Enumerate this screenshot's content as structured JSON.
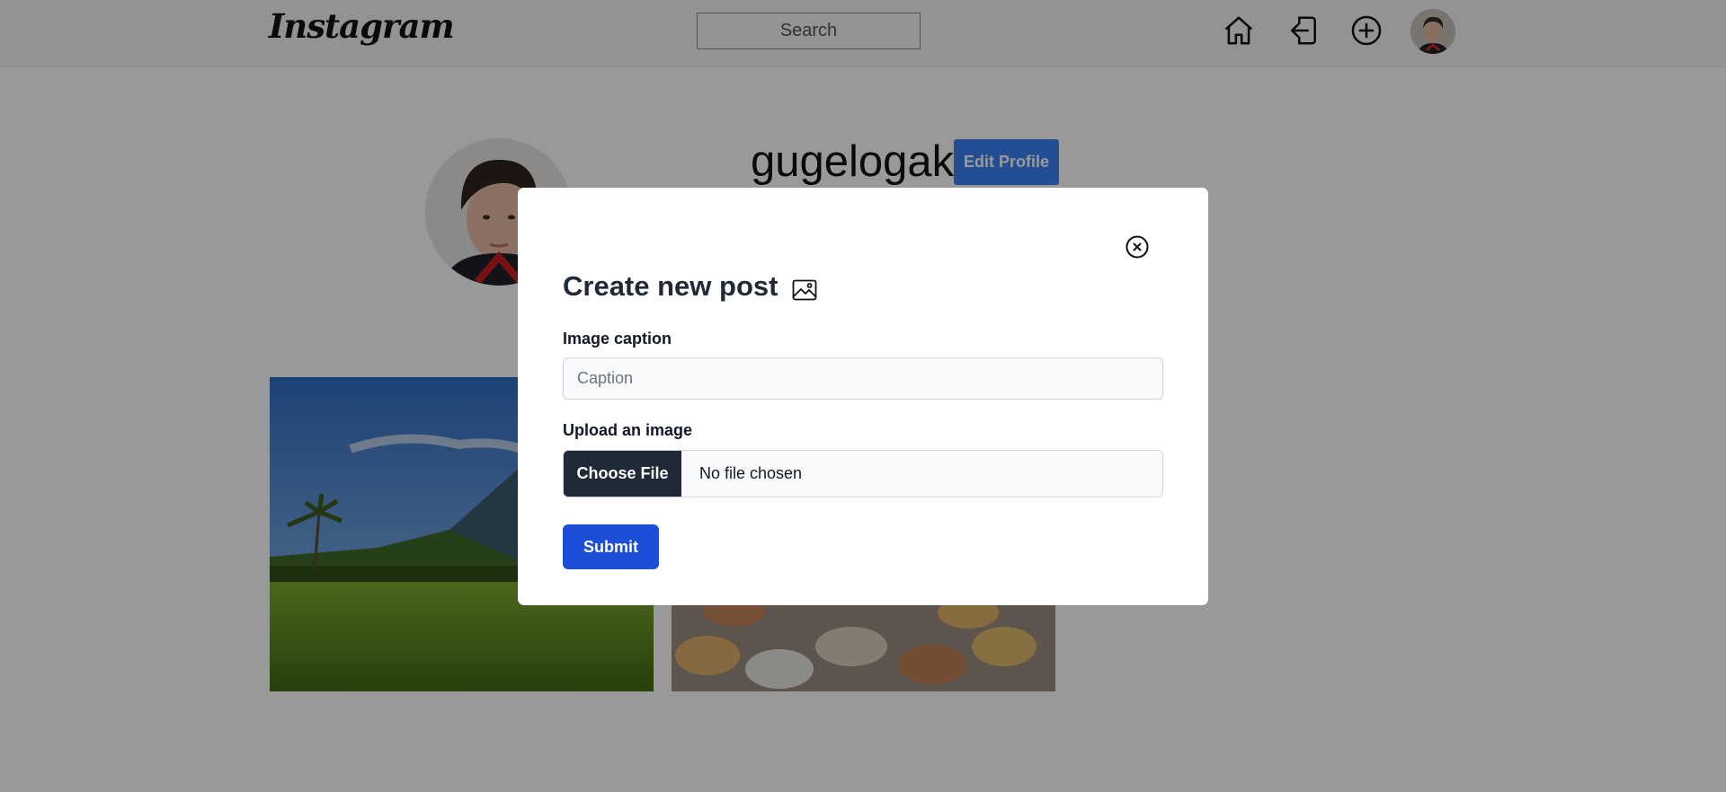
{
  "navbar": {
    "logo": "Instagram",
    "search_placeholder": "Search",
    "icons": [
      "home-icon",
      "logout-icon",
      "add-post-icon",
      "avatar"
    ]
  },
  "profile": {
    "username": "gugelogak",
    "edit_label": "Edit Profile"
  },
  "modal": {
    "title": "Create new post",
    "caption_label": "Image caption",
    "caption_placeholder": "Caption",
    "caption_value": "",
    "upload_label": "Upload an image",
    "file_button": "Choose File",
    "file_status": "No file chosen",
    "submit_label": "Submit"
  },
  "colors": {
    "overlay": "rgba(0,0,0,0.40)",
    "edit_profile": "#3b82f6",
    "submit": "#1d4ed8",
    "file_button": "#1f2937"
  }
}
